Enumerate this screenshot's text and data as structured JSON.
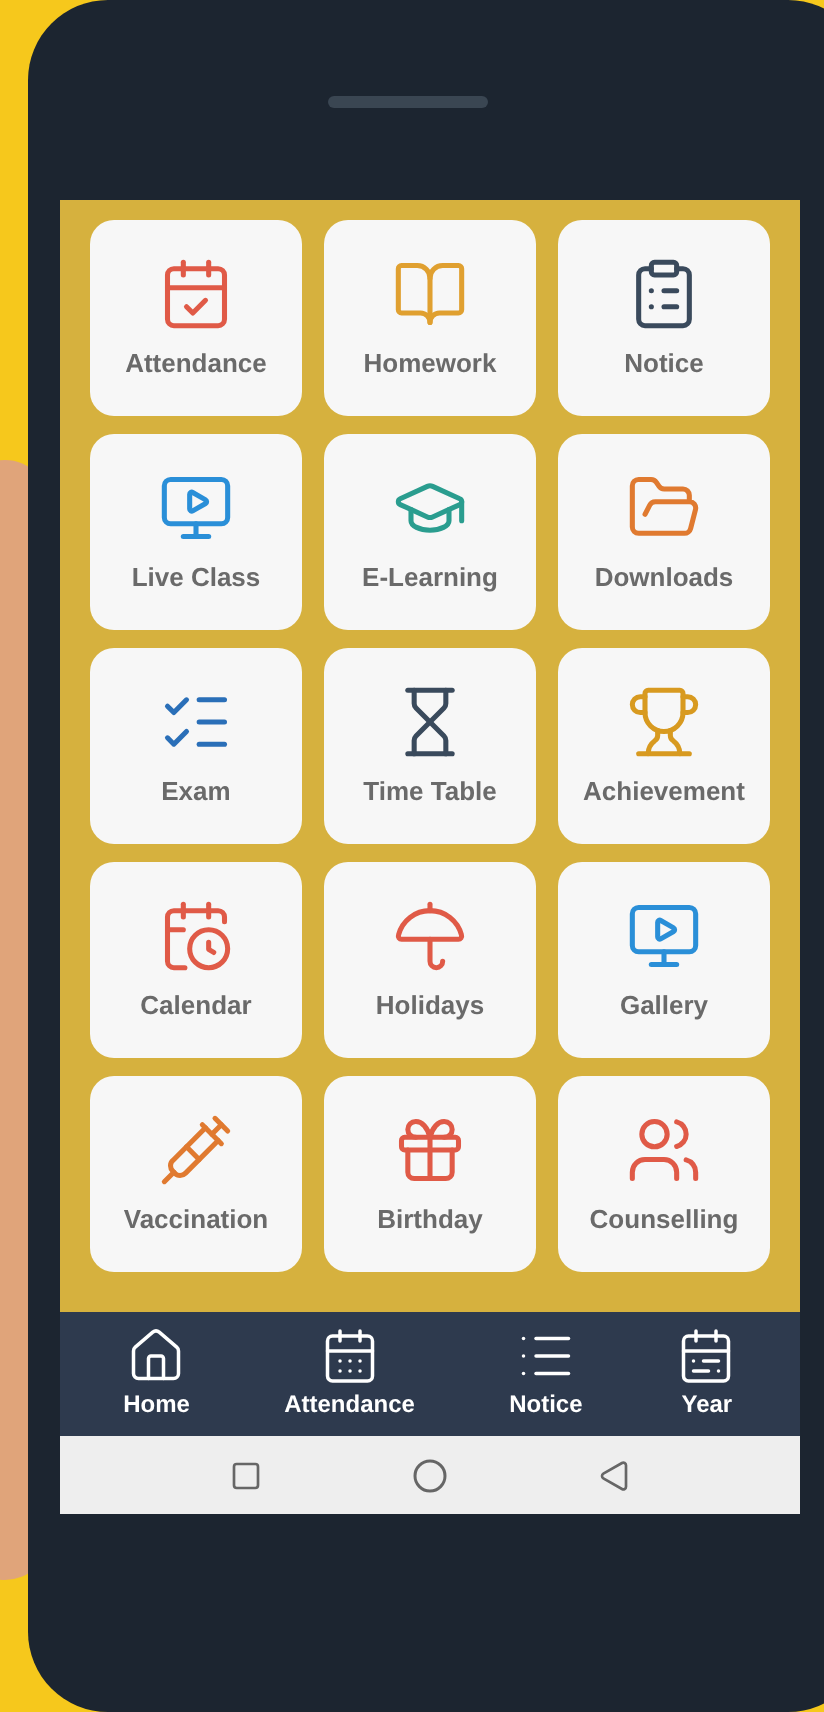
{
  "tiles": [
    {
      "label": "Attendance"
    },
    {
      "label": "Homework"
    },
    {
      "label": "Notice"
    },
    {
      "label": "Live Class"
    },
    {
      "label": "E-Learning"
    },
    {
      "label": "Downloads"
    },
    {
      "label": "Exam"
    },
    {
      "label": "Time Table"
    },
    {
      "label": "Achievement"
    },
    {
      "label": "Calendar"
    },
    {
      "label": "Holidays"
    },
    {
      "label": "Gallery"
    },
    {
      "label": "Vaccination"
    },
    {
      "label": "Birthday"
    },
    {
      "label": "Counselling"
    }
  ],
  "bottom_nav": [
    {
      "label": "Home"
    },
    {
      "label": "Attendance"
    },
    {
      "label": "Notice"
    },
    {
      "label": "Year"
    }
  ]
}
